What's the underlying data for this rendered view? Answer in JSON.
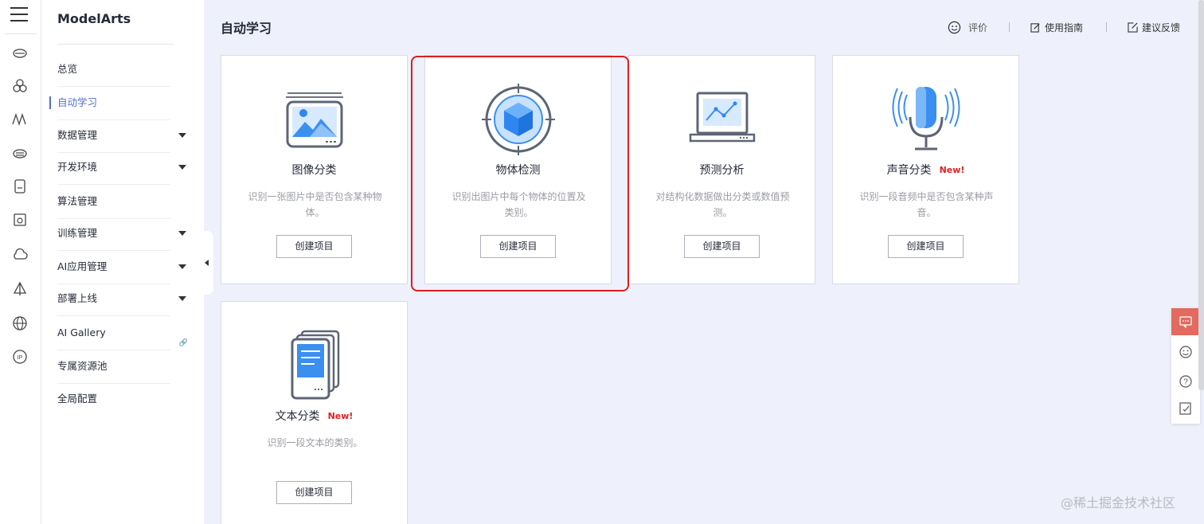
{
  "app": {
    "brand": "ModelArts"
  },
  "rail": {
    "icons": [
      "menu-icon",
      "cloud-icon",
      "cluster-icon",
      "wave-icon",
      "cloud-storage-icon",
      "device-icon",
      "box-icon",
      "cloud-outline-icon",
      "sail-icon",
      "globe-icon",
      "ip-icon"
    ]
  },
  "nav": {
    "items": [
      {
        "label": "总览",
        "active": false,
        "caret": false
      },
      {
        "label": "自动学习",
        "active": true,
        "caret": false
      },
      {
        "label": "数据管理",
        "active": false,
        "caret": true
      },
      {
        "label": "开发环境",
        "active": false,
        "caret": true
      },
      {
        "label": "算法管理",
        "active": false,
        "caret": false
      },
      {
        "label": "训练管理",
        "active": false,
        "caret": true
      },
      {
        "label": "AI应用管理",
        "active": false,
        "caret": true
      },
      {
        "label": "部署上线",
        "active": false,
        "caret": true
      },
      {
        "label": "AI Gallery",
        "active": false,
        "caret": false,
        "link": "link-icon"
      },
      {
        "label": "专属资源池",
        "active": false,
        "caret": false
      },
      {
        "label": "全局配置",
        "active": false,
        "caret": false
      }
    ]
  },
  "header": {
    "title": "自动学习",
    "rate_label": "评价",
    "guide_label": "使用指南",
    "feedback_label": "建议反馈"
  },
  "cards": [
    {
      "title": "图像分类",
      "new": "",
      "desc": "识别一张图片中是否包含某种物体。",
      "button": "创建项目",
      "icon": "image-classification-icon"
    },
    {
      "title": "物体检测",
      "new": "",
      "desc": "识别出图片中每个物体的位置及类别。",
      "button": "创建项目",
      "icon": "object-detection-icon"
    },
    {
      "title": "预测分析",
      "new": "",
      "desc": "对结构化数据做出分类或数值预测。",
      "button": "创建项目",
      "icon": "prediction-analysis-icon"
    },
    {
      "title": "声音分类",
      "new": "New!",
      "desc": "识别一段音频中是否包含某种声音。",
      "button": "创建项目",
      "icon": "sound-classification-icon"
    },
    {
      "title": "文本分类",
      "new": "New!",
      "desc": "识别一段文本的类别。",
      "button": "创建项目",
      "icon": "text-classification-icon"
    }
  ],
  "float_toolbar": [
    "chat-icon",
    "smile-icon",
    "help-icon",
    "edit-icon"
  ],
  "watermark": "@稀土掘金技术社区",
  "colors": {
    "accent": "#526ecc",
    "highlight": "#e01e1e",
    "new": "#e02020",
    "float_top": "#e26a5e"
  }
}
